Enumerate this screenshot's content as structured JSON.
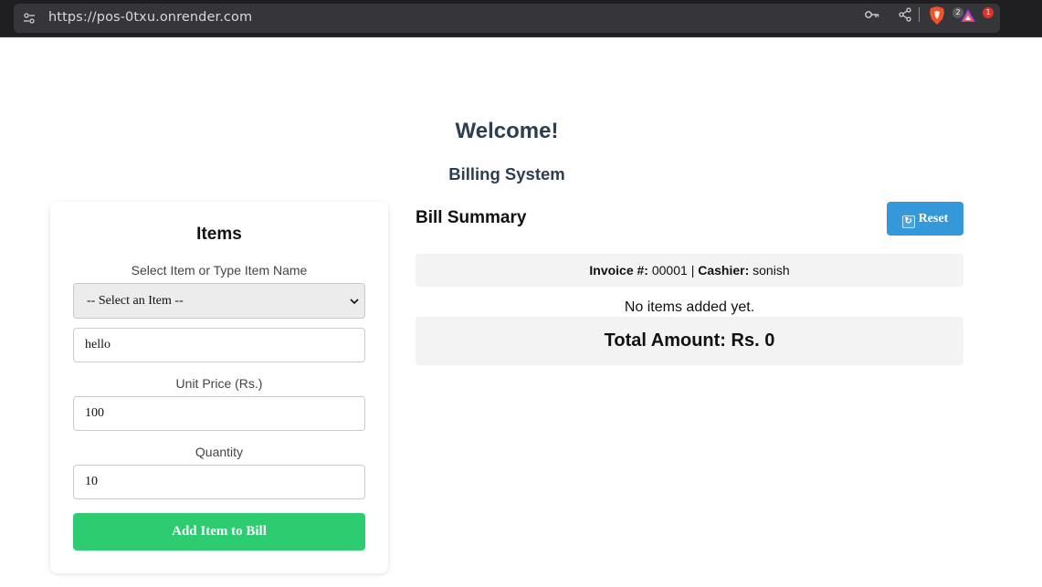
{
  "browser": {
    "url": "https://pos-0txu.onrender.com",
    "shield_badge": "2",
    "rewards_badge": "1"
  },
  "page": {
    "welcome": "Welcome!",
    "subtitle": "Billing System"
  },
  "items_panel": {
    "title": "Items",
    "select_label": "Select Item or Type Item Name",
    "select_value": "-- Select an Item --",
    "item_name_value": "hello",
    "price_label": "Unit Price (Rs.)",
    "price_value": "100",
    "quantity_label": "Quantity",
    "quantity_value": "10",
    "add_button": "Add Item to Bill"
  },
  "bill": {
    "title": "Bill Summary",
    "reset_button": "Reset",
    "invoice_label": "Invoice #:",
    "invoice_number": "00001",
    "separator": "|",
    "cashier_label": "Cashier:",
    "cashier_name": "sonish",
    "empty_message": "No items added yet.",
    "total_text": "Total Amount: Rs. 0"
  },
  "colors": {
    "heading": "#2c3e50",
    "add_button": "#2ecc71",
    "reset_button": "#3498db"
  }
}
